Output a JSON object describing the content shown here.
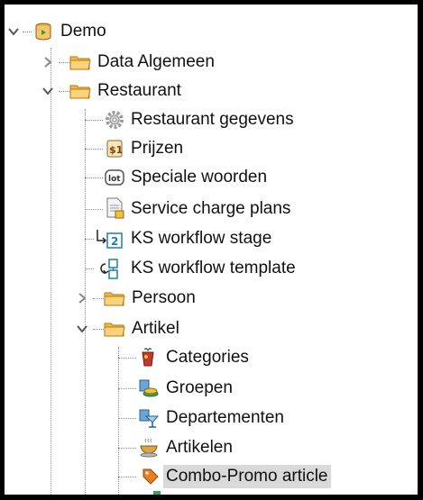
{
  "tree": {
    "root": {
      "label": "Demo",
      "expanded": true,
      "icon": "database-icon"
    },
    "items": [
      {
        "label": "Data Algemeen",
        "icon": "folder-icon",
        "toggle": "collapsed"
      },
      {
        "label": "Restaurant",
        "icon": "folder-icon",
        "toggle": "expanded"
      },
      {
        "label": "Restaurant gegevens",
        "icon": "gear-icon"
      },
      {
        "label": "Prijzen",
        "icon": "price-tag-icon"
      },
      {
        "label": "Speciale woorden",
        "icon": "text-field-icon"
      },
      {
        "label": "Service charge plans",
        "icon": "document-icon"
      },
      {
        "label": "KS workflow stage",
        "icon": "workflow-stage-icon"
      },
      {
        "label": "KS workflow template",
        "icon": "workflow-template-icon"
      },
      {
        "label": "Persoon",
        "icon": "folder-icon",
        "toggle": "collapsed"
      },
      {
        "label": "Artikel",
        "icon": "folder-icon",
        "toggle": "expanded"
      },
      {
        "label": "Categories",
        "icon": "categories-icon"
      },
      {
        "label": "Groepen",
        "icon": "groups-icon"
      },
      {
        "label": "Departementen",
        "icon": "departments-icon"
      },
      {
        "label": "Artikelen",
        "icon": "articles-icon"
      },
      {
        "label": "Combo-Promo article",
        "icon": "combo-promo-icon",
        "selected": true
      }
    ],
    "badge_text": {
      "prijzen": "$1",
      "woorden": "lot",
      "stage": "2"
    }
  },
  "colors": {
    "folder": "#f4b942",
    "folder_outline": "#b07a12",
    "selection": "#d9d9d9",
    "workflow": "#1f7fa8",
    "background": "#ffffff",
    "frame": "#000000"
  }
}
